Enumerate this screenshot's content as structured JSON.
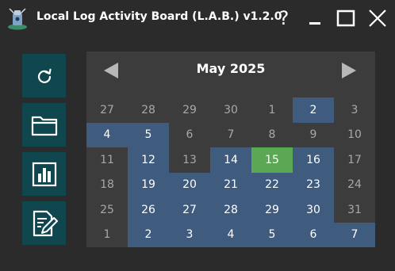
{
  "window": {
    "title": "Local Log Activity Board (L.A.B.) v1.2.0",
    "help_label": "?"
  },
  "sidebar": {
    "buttons": [
      {
        "name": "refresh",
        "icon": "refresh-icon"
      },
      {
        "name": "open-folder",
        "icon": "folder-icon"
      },
      {
        "name": "statistics",
        "icon": "bar-chart-icon"
      },
      {
        "name": "log-entry",
        "icon": "edit-document-icon"
      }
    ]
  },
  "calendar": {
    "month_label": "May 2025",
    "colors": {
      "background": "#3c3c3c",
      "highlight": "#3f5b7e",
      "today": "#5aa853",
      "muted_text": "#a8a8a8"
    },
    "days": [
      {
        "label": "27",
        "state": "other"
      },
      {
        "label": "28",
        "state": "other"
      },
      {
        "label": "29",
        "state": "other"
      },
      {
        "label": "30",
        "state": "other"
      },
      {
        "label": "1",
        "state": "dim"
      },
      {
        "label": "2",
        "state": "hl"
      },
      {
        "label": "3",
        "state": "dim"
      },
      {
        "label": "4",
        "state": "hl"
      },
      {
        "label": "5",
        "state": "hl"
      },
      {
        "label": "6",
        "state": "dim"
      },
      {
        "label": "7",
        "state": "dim"
      },
      {
        "label": "8",
        "state": "dim"
      },
      {
        "label": "9",
        "state": "dim"
      },
      {
        "label": "10",
        "state": "dim"
      },
      {
        "label": "11",
        "state": "dim"
      },
      {
        "label": "12",
        "state": "hl"
      },
      {
        "label": "13",
        "state": "dim"
      },
      {
        "label": "14",
        "state": "hl"
      },
      {
        "label": "15",
        "state": "today"
      },
      {
        "label": "16",
        "state": "hl"
      },
      {
        "label": "17",
        "state": "dim"
      },
      {
        "label": "18",
        "state": "dim"
      },
      {
        "label": "19",
        "state": "hl"
      },
      {
        "label": "20",
        "state": "hl"
      },
      {
        "label": "21",
        "state": "hl"
      },
      {
        "label": "22",
        "state": "hl"
      },
      {
        "label": "23",
        "state": "hl"
      },
      {
        "label": "24",
        "state": "dim"
      },
      {
        "label": "25",
        "state": "dim"
      },
      {
        "label": "26",
        "state": "hl"
      },
      {
        "label": "27",
        "state": "hl"
      },
      {
        "label": "28",
        "state": "hl"
      },
      {
        "label": "29",
        "state": "hl"
      },
      {
        "label": "30",
        "state": "hl"
      },
      {
        "label": "31",
        "state": "dim"
      },
      {
        "label": "1",
        "state": "other"
      },
      {
        "label": "2",
        "state": "hl"
      },
      {
        "label": "3",
        "state": "hl"
      },
      {
        "label": "4",
        "state": "hl"
      },
      {
        "label": "5",
        "state": "hl"
      },
      {
        "label": "6",
        "state": "hl"
      },
      {
        "label": "7",
        "state": "hl"
      }
    ]
  }
}
